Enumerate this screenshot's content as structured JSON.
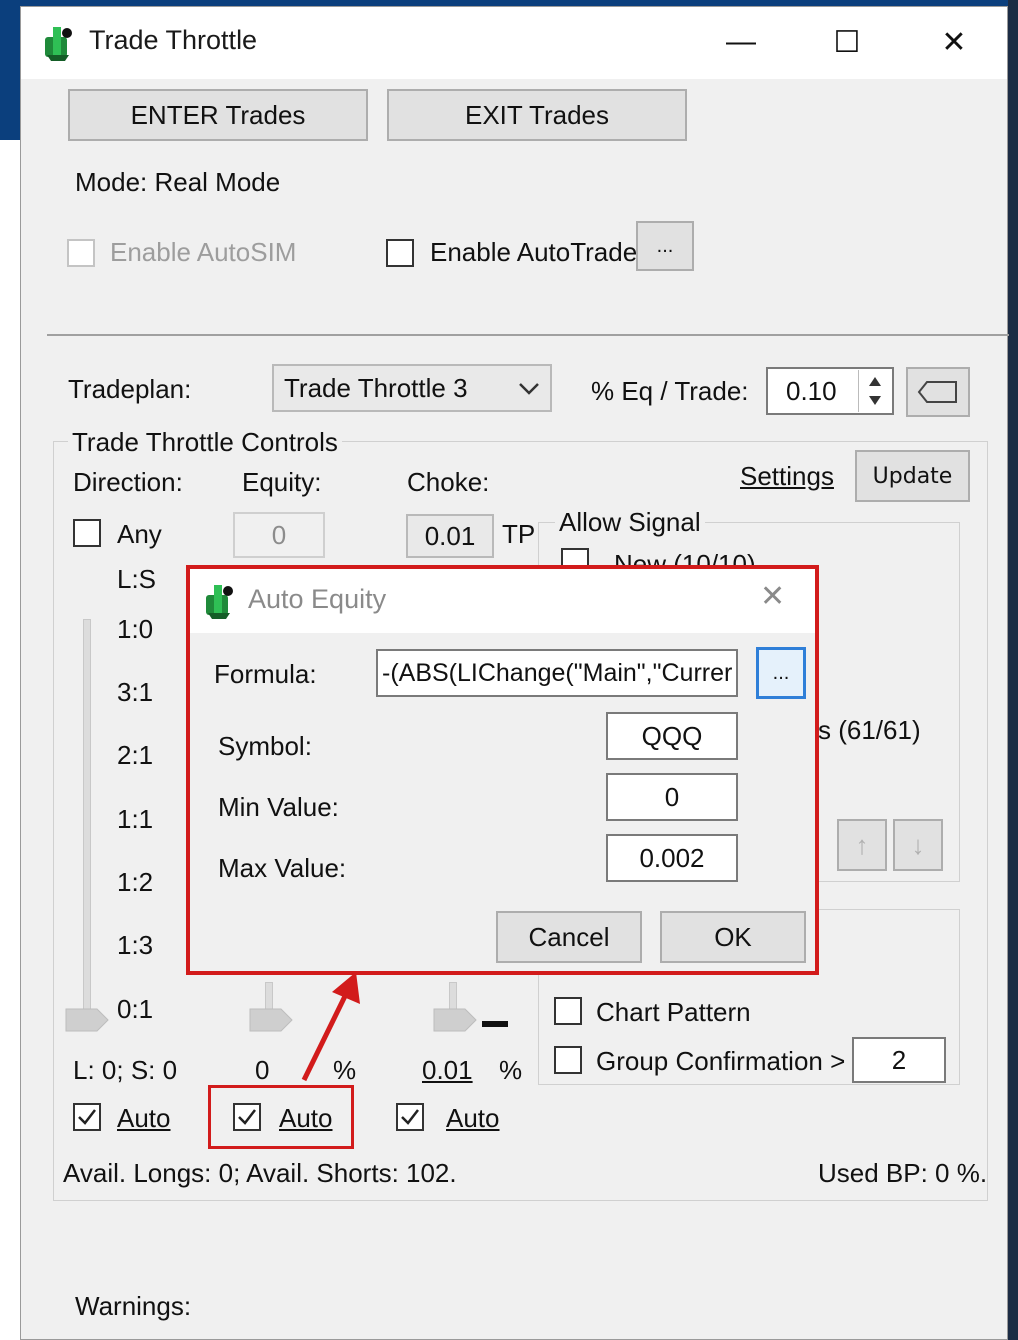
{
  "window": {
    "title": "Trade Throttle",
    "controls": {
      "minimize": "—",
      "maximize": "☐",
      "close": "✕"
    }
  },
  "toolbar": {
    "enter_label": "ENTER Trades",
    "exit_label": "EXIT Trades"
  },
  "mode_text": "Mode: Real Mode",
  "options": {
    "autosim_label": "Enable AutoSIM",
    "autotrade_label": "Enable AutoTrade",
    "autotrade_more": "..."
  },
  "tradeplan": {
    "label": "Tradeplan:",
    "selected": "Trade Throttle 3",
    "eq_label": "% Eq / Trade:",
    "eq_value": "0.10"
  },
  "controls": {
    "group_title": "Trade Throttle Controls",
    "direction_label": "Direction:",
    "equity_label": "Equity:",
    "choke_label": "Choke:",
    "settings_link": "Settings",
    "update_label": "Update",
    "any_label": "Any",
    "equity_value": "0",
    "choke_value": "0.01",
    "tp_label": "TP",
    "ls_label": "L:S",
    "ratios": [
      "1:0",
      "3:1",
      "2:1",
      "1:1",
      "1:2",
      "1:3",
      "0:1"
    ],
    "ls_status": "L: 0; S: 0",
    "equity_status": "0",
    "equity_pct": "%",
    "choke_status": "0.01",
    "choke_pct": "%",
    "auto_label": "Auto",
    "avail_text": "Avail. Longs: 0; Avail. Shorts: 102.",
    "used_bp_text": "Used BP: 0 %."
  },
  "allow_signal": {
    "title": "Allow Signal",
    "new_partial": "New (10/10)",
    "count_partial": "s (61/61)",
    "up_arrow": "↑",
    "down_arrow": "↓",
    "chart_pattern": "Chart Pattern",
    "group_confirmation": "Group Confirmation >",
    "group_confirmation_value": "2"
  },
  "warnings_label": "Warnings:",
  "dialog": {
    "title": "Auto Equity",
    "close": "✕",
    "formula_label": "Formula:",
    "formula_value": "-(ABS(LIChange(\"Main\",\"Currer",
    "formula_more": "...",
    "symbol_label": "Symbol:",
    "symbol_value": "QQQ",
    "min_label": "Min Value:",
    "min_value": "0",
    "max_label": "Max Value:",
    "max_value": "0.002",
    "cancel_label": "Cancel",
    "ok_label": "OK"
  },
  "colors": {
    "highlight": "#d21b1b",
    "desktop": "#0b3f7d",
    "window_bg": "#f0f0f0"
  }
}
